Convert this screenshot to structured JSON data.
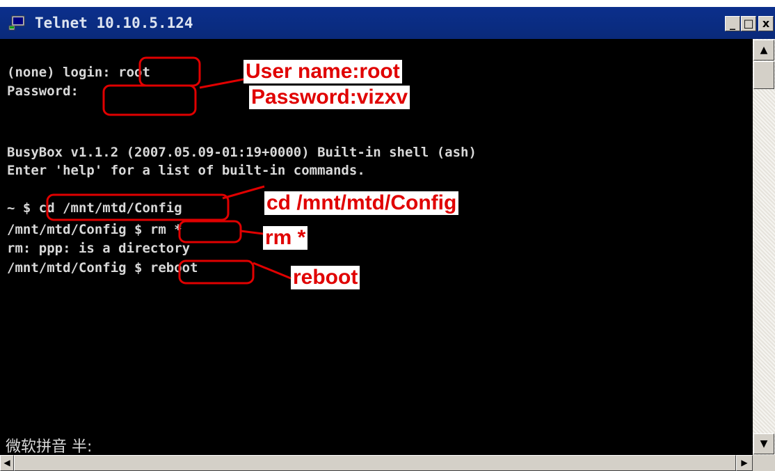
{
  "window": {
    "title": "Telnet 10.10.5.124",
    "minimize_label": "_",
    "maximize_label": "□",
    "close_label": "x"
  },
  "terminal": {
    "lines": [
      "(none) login: root",
      "Password:",
      "BusyBox v1.1.2 (2007.05.09-01:19+0000) Built-in shell (ash)",
      "Enter 'help' for a list of built-in commands.",
      "~ $ cd /mnt/mtd/Config",
      "/mnt/mtd/Config $ rm *",
      "rm: ppp: is a directory",
      "/mnt/mtd/Config $ reboot"
    ],
    "ime_status": "微软拼音 半:"
  },
  "annotations": {
    "credentials_user": "User name:root",
    "credentials_password": "Password:vizxv",
    "cd_command": "cd /mnt/mtd/Config",
    "rm_command": "rm *",
    "reboot_command": "reboot"
  },
  "colors": {
    "annotation_red": "#e00000",
    "terminal_background": "#000000",
    "titlebar_blue": "#0a2a7a"
  },
  "icons": {
    "title": "telnet-terminal-icon",
    "scroll_up": "arrow-up-icon",
    "scroll_down": "arrow-down-icon",
    "scroll_left": "arrow-left-icon",
    "scroll_right": "arrow-right-icon"
  }
}
